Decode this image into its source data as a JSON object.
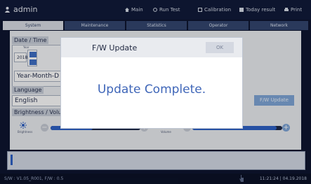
{
  "topbar": {
    "user": "admin",
    "items": [
      {
        "label": "Main",
        "icon": "home-icon"
      },
      {
        "label": "Run Test",
        "icon": "circle-icon"
      },
      {
        "label": "Calibration",
        "icon": "square-icon"
      },
      {
        "label": "Today result",
        "icon": "list-icon"
      },
      {
        "label": "Print",
        "icon": "printer-icon"
      }
    ]
  },
  "tabs": [
    {
      "label": "System",
      "active": true
    },
    {
      "label": "Maintenance",
      "active": false
    },
    {
      "label": "Statistics",
      "active": false
    },
    {
      "label": "Operator",
      "active": false
    },
    {
      "label": "Network",
      "active": false
    }
  ],
  "settings": {
    "date_time_label": "Date / Time",
    "year_label": "Year",
    "year_value": "2018",
    "date_format": "Year-Month-D",
    "language_label": "Language",
    "language_value": "English",
    "brightness_volume_label": "Brightness / Volum",
    "brightness_label": "Brightness",
    "volume_label": "Volume",
    "fw_update_button": "F/W Update"
  },
  "modal": {
    "title": "F/W Update",
    "ok_label": "OK",
    "message": "Update Complete."
  },
  "status": {
    "version": "S/W : V1.05_R001, F/W : 0.5",
    "datetime": "11:21:24 | 04.19.2018"
  },
  "colors": {
    "accent": "#2f62c7",
    "modal_text": "#3f66b8",
    "background": "#0e1530"
  }
}
